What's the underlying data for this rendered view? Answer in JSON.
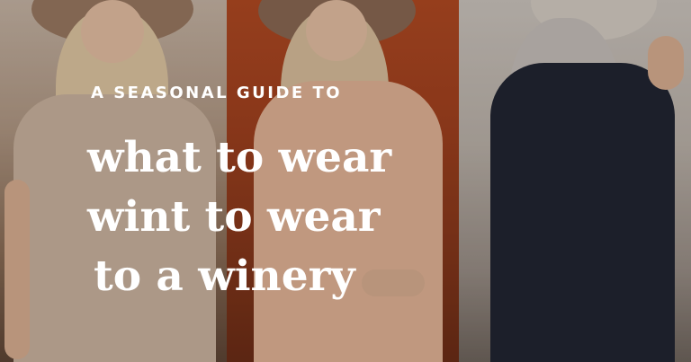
{
  "image": {
    "subject": "photo-collage",
    "panels": [
      "left-panel",
      "center-panel",
      "right-panel"
    ]
  },
  "overlay_text": {
    "kicker": "A SEASONAL GUIDE TO",
    "title_line_1": "what to wear",
    "title_line_2": "wint to wear",
    "title_line_3": "to a winery"
  },
  "colors": {
    "text": "#ffffff",
    "panel_left": "#b39c88",
    "panel_center": "#a5421f",
    "panel_right": "#bdb6ae"
  }
}
